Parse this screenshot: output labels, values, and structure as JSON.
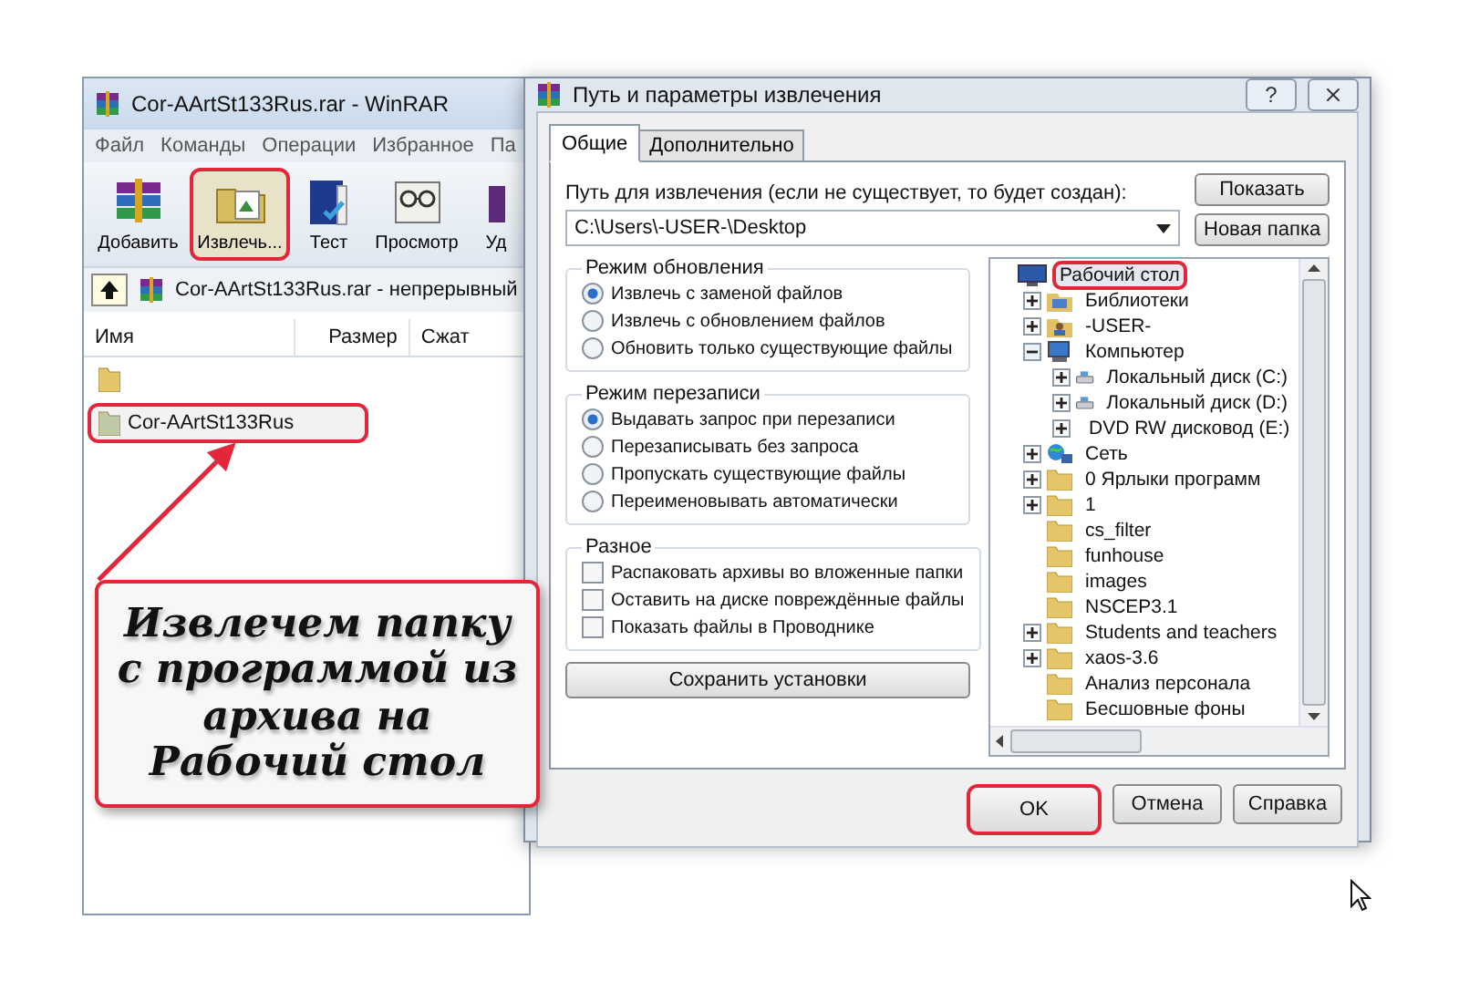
{
  "winrar": {
    "title": "Cor-AArtSt133Rus.rar - WinRAR",
    "menu": [
      "Файл",
      "Команды",
      "Операции",
      "Избранное",
      "Па"
    ],
    "toolbar": [
      {
        "label": "Добавить",
        "kind": "add",
        "highlighted": false
      },
      {
        "label": "Извлечь...",
        "kind": "extract",
        "highlighted": true
      },
      {
        "label": "Тест",
        "kind": "test",
        "highlighted": false
      },
      {
        "label": "Просмотр",
        "kind": "view",
        "highlighted": false
      },
      {
        "label": "Уд",
        "kind": "delete",
        "highlighted": false
      }
    ],
    "address": "Cor-AArtSt133Rus.rar - непрерывный",
    "columns": [
      "Имя",
      "Размер",
      "Сжат"
    ],
    "rows": [
      {
        "kind": "parent",
        "highlighted": false
      },
      {
        "kind": "folder",
        "name": "Cor-AArtSt133Rus",
        "highlighted": true
      }
    ]
  },
  "callout": {
    "text": "Извлечем папку с программой из архива на Рабочий стол"
  },
  "dialog": {
    "title": "Путь и параметры извлечения",
    "help_button": "?",
    "tabs": [
      {
        "label": "Общие",
        "selected": true
      },
      {
        "label": "Дополнительно",
        "selected": false
      }
    ],
    "path_label": "Путь для извлечения (если не существует, то будет создан):",
    "path_value": "C:\\Users\\-USER-\\Desktop",
    "show_button": "Показать",
    "new_folder_button": "Новая папка",
    "groups": [
      {
        "title": "Режим обновления",
        "kind": "radio",
        "options": [
          {
            "label": "Извлечь с заменой файлов",
            "selected": true
          },
          {
            "label": "Извлечь с обновлением файлов",
            "selected": false
          },
          {
            "label": "Обновить только существующие файлы",
            "selected": false
          }
        ]
      },
      {
        "title": "Режим перезаписи",
        "kind": "radio",
        "options": [
          {
            "label": "Выдавать запрос при перезаписи",
            "selected": true
          },
          {
            "label": "Перезаписывать без запроса",
            "selected": false
          },
          {
            "label": "Пропускать существующие файлы",
            "selected": false
          },
          {
            "label": "Переименовывать автоматически",
            "selected": false
          }
        ]
      },
      {
        "title": "Разное",
        "kind": "checkbox",
        "options": [
          {
            "label": "Распаковать архивы во вложенные папки",
            "checked": false
          },
          {
            "label": "Оставить на диске повреждённые файлы",
            "checked": false
          },
          {
            "label": "Показать файлы в Проводнике",
            "checked": false
          }
        ]
      }
    ],
    "save_button": "Сохранить установки",
    "tree": [
      {
        "label": "Рабочий стол",
        "kind": "desktop",
        "has_children": false,
        "selected": true,
        "highlighted": true,
        "children": [
          {
            "label": "Библиотеки",
            "kind": "library",
            "has_children": true,
            "expanded": false,
            "selected": false,
            "highlighted": false
          },
          {
            "label": "-USER-",
            "kind": "user",
            "has_children": true,
            "expanded": false,
            "selected": false,
            "highlighted": false
          },
          {
            "label": "Компьютер",
            "kind": "computer",
            "has_children": true,
            "expanded": true,
            "selected": false,
            "highlighted": false,
            "children": [
              {
                "label": "Локальный диск (C:)",
                "kind": "drive",
                "has_children": true,
                "expanded": false,
                "selected": false,
                "highlighted": false
              },
              {
                "label": "Локальный диск (D:)",
                "kind": "drive",
                "has_children": true,
                "expanded": false,
                "selected": false,
                "highlighted": false
              },
              {
                "label": "DVD RW дисковод (E:)",
                "kind": "dvd",
                "has_children": true,
                "expanded": false,
                "selected": false,
                "highlighted": false
              }
            ]
          },
          {
            "label": "Сеть",
            "kind": "network",
            "has_children": true,
            "expanded": false,
            "selected": false,
            "highlighted": false
          },
          {
            "label": "0 Ярлыки программ",
            "kind": "folder",
            "has_children": true,
            "expanded": false,
            "selected": false,
            "highlighted": false
          },
          {
            "label": "1",
            "kind": "folder",
            "has_children": true,
            "expanded": false,
            "selected": false,
            "highlighted": false
          },
          {
            "label": "cs_filter",
            "kind": "folder",
            "has_children": false,
            "selected": false,
            "highlighted": false
          },
          {
            "label": "funhouse",
            "kind": "folder",
            "has_children": false,
            "selected": false,
            "highlighted": false
          },
          {
            "label": "images",
            "kind": "folder",
            "has_children": false,
            "selected": false,
            "highlighted": false
          },
          {
            "label": "NSCEP3.1",
            "kind": "folder",
            "has_children": false,
            "selected": false,
            "highlighted": false
          },
          {
            "label": "Students and teachers",
            "kind": "folder",
            "has_children": true,
            "expanded": false,
            "selected": false,
            "highlighted": false
          },
          {
            "label": "xaos-3.6",
            "kind": "folder",
            "has_children": true,
            "expanded": false,
            "selected": false,
            "highlighted": false
          },
          {
            "label": "Анализ персонала",
            "kind": "folder",
            "has_children": false,
            "selected": false,
            "highlighted": false
          },
          {
            "label": "Бесшовные фоны",
            "kind": "folder",
            "has_children": false,
            "selected": false,
            "highlighted": false
          }
        ]
      }
    ],
    "buttons": [
      {
        "label": "OK",
        "highlighted": true
      },
      {
        "label": "Отмена",
        "highlighted": false
      },
      {
        "label": "Справка",
        "highlighted": false
      }
    ]
  }
}
